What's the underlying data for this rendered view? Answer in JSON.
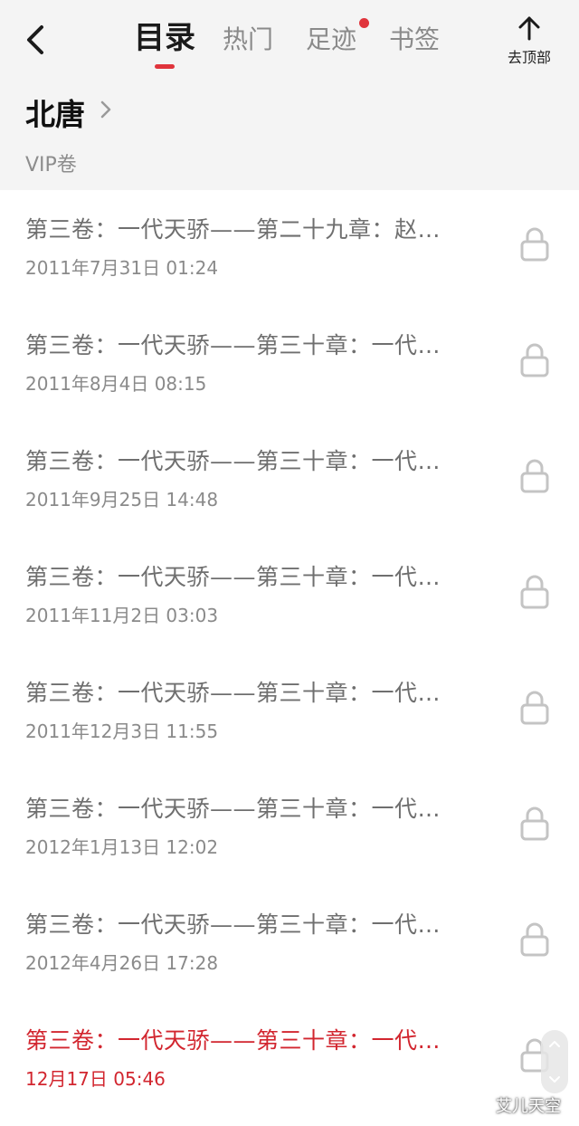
{
  "header": {
    "tabs": [
      {
        "label": "目录",
        "active": true
      },
      {
        "label": "热门",
        "active": false
      },
      {
        "label": "足迹",
        "active": false,
        "badge_dot": true
      },
      {
        "label": "书签",
        "active": false
      }
    ],
    "to_top_label": "去顶部",
    "accent_color": "#e0343c"
  },
  "book": {
    "title": "北唐",
    "volume": "VIP卷"
  },
  "chapters": [
    {
      "title": "第三卷：一代天骄——第二十九章：赵…",
      "date": "2011年7月31日 01:24",
      "locked": true,
      "current": false
    },
    {
      "title": "第三卷：一代天骄——第三十章：一代…",
      "date": "2011年8月4日 08:15",
      "locked": true,
      "current": false
    },
    {
      "title": "第三卷：一代天骄——第三十章：一代…",
      "date": "2011年9月25日 14:48",
      "locked": true,
      "current": false
    },
    {
      "title": "第三卷：一代天骄——第三十章：一代…",
      "date": "2011年11月2日 03:03",
      "locked": true,
      "current": false
    },
    {
      "title": "第三卷：一代天骄——第三十章：一代…",
      "date": "2011年12月3日 11:55",
      "locked": true,
      "current": false
    },
    {
      "title": "第三卷：一代天骄——第三十章：一代…",
      "date": "2012年1月13日 12:02",
      "locked": true,
      "current": false
    },
    {
      "title": "第三卷：一代天骄——第三十章：一代…",
      "date": "2012年4月26日 17:28",
      "locked": true,
      "current": false
    },
    {
      "title": "第三卷：一代天骄——第三十章：一代…",
      "date": "12月17日 05:46",
      "locked": true,
      "current": true
    }
  ],
  "watermark": "艾儿天空"
}
